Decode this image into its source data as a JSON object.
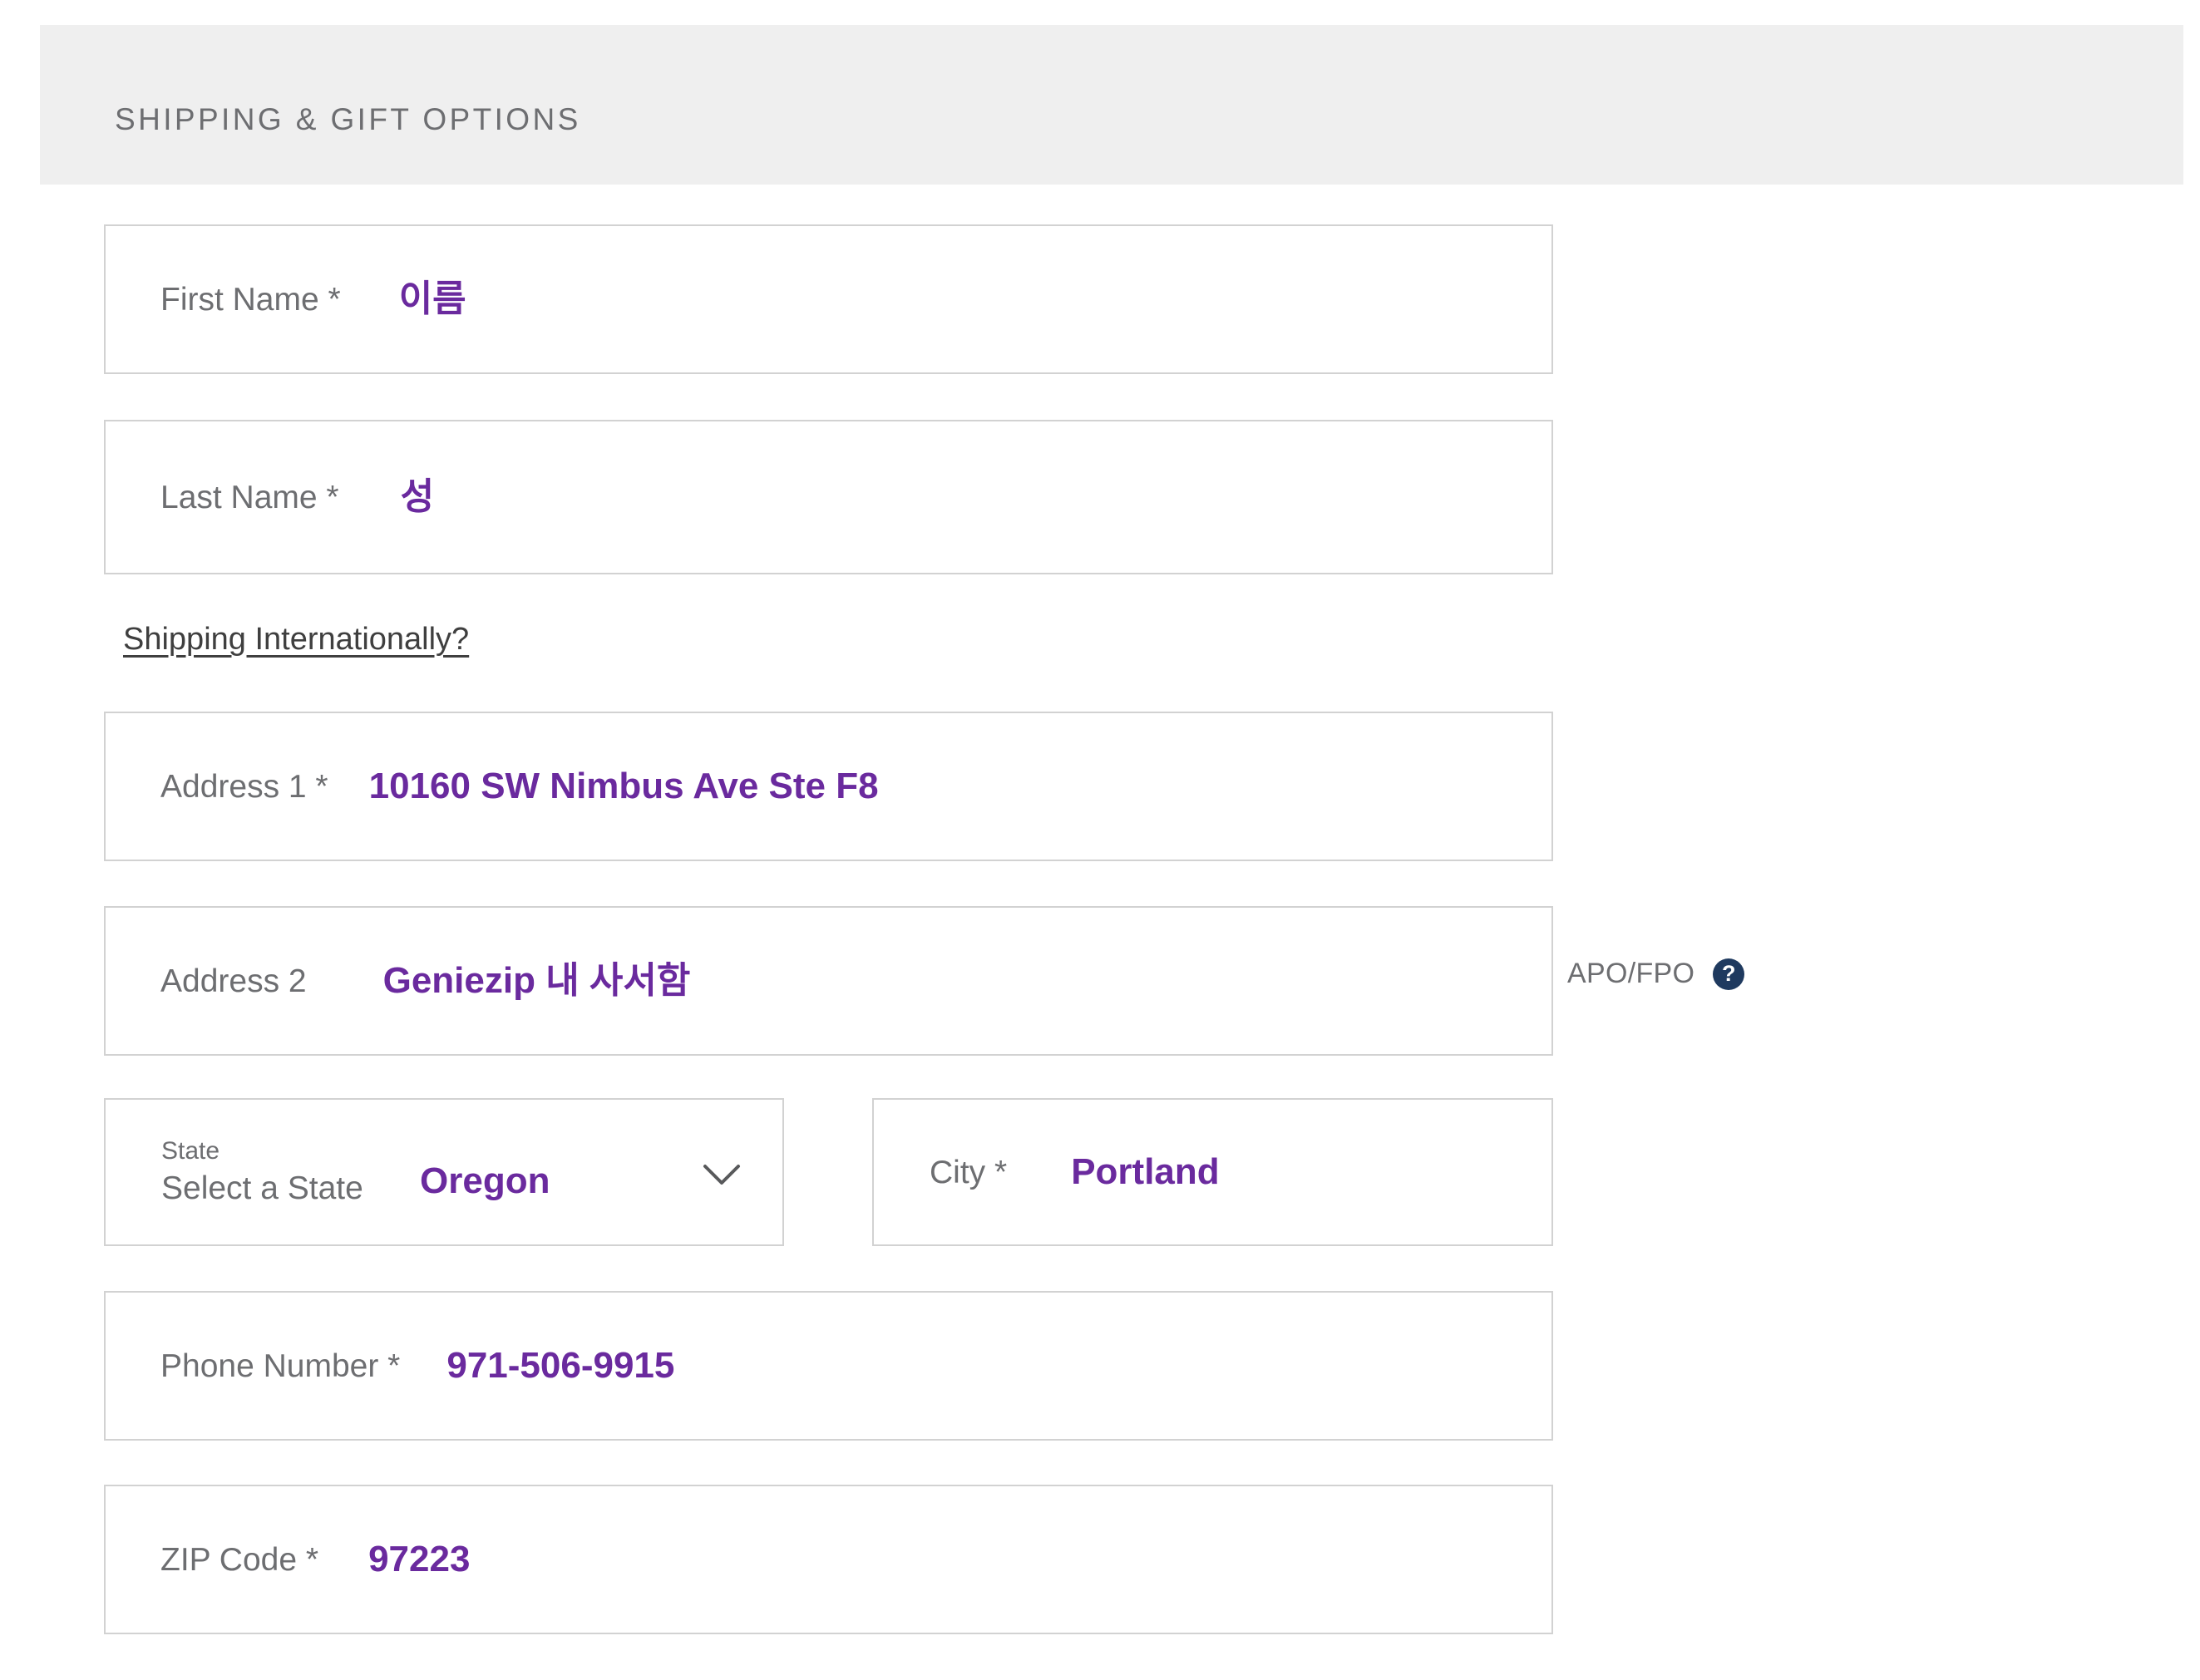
{
  "section": {
    "title": "SHIPPING & GIFT OPTIONS",
    "header_bg": "#efefef",
    "label_color": "#6d6e71",
    "value_color": "#6a2a9e",
    "border_color": "#d2d2d2"
  },
  "fields": {
    "first_name": {
      "label": "First Name *",
      "value": "이름",
      "placeholder": ""
    },
    "last_name": {
      "label": "Last Name *",
      "value": "성",
      "placeholder": ""
    },
    "address1": {
      "label": "Address 1 *",
      "value": "10160 SW Nimbus Ave Ste F8",
      "placeholder": ""
    },
    "address2": {
      "label": "Address 2",
      "value": "Geniezip 내 사서함",
      "placeholder": ""
    },
    "state": {
      "label": "State",
      "placeholder": "Select a State",
      "value": "Oregon"
    },
    "city": {
      "label": "City *",
      "value": "Portland",
      "placeholder": ""
    },
    "phone": {
      "label": "Phone Number *",
      "value": "971-506-9915",
      "placeholder": ""
    },
    "zip": {
      "label": "ZIP Code *",
      "value": "97223",
      "placeholder": ""
    }
  },
  "links": {
    "shipping_internationally": "Shipping Internationally?"
  },
  "apo_fpo": {
    "label": "APO/FPO",
    "help_glyph": "?",
    "help_icon_color": "#1f3a5f"
  }
}
